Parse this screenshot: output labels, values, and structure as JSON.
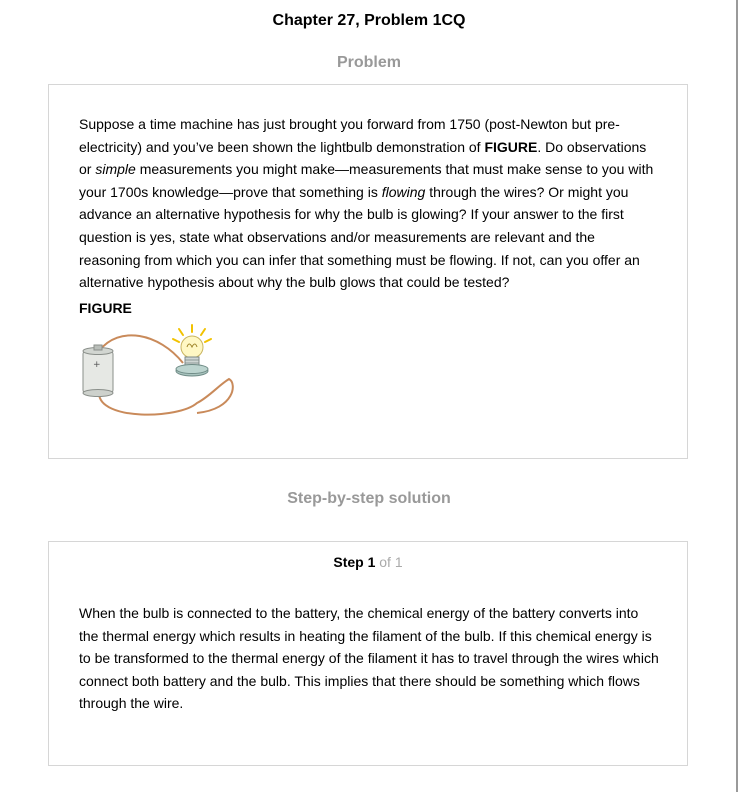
{
  "page_title": "Chapter 27, Problem 1CQ",
  "problem_heading": "Problem",
  "problem": {
    "segments": [
      {
        "text": "Suppose a time machine has just brought you forward from 1750 (post-Newton but pre-electricity) and you’ve been shown the lightbulb demonstration of ",
        "style": "normal"
      },
      {
        "text": "FIGURE",
        "style": "bold"
      },
      {
        "text": ". Do observations or ",
        "style": "normal"
      },
      {
        "text": "simple",
        "style": "italic"
      },
      {
        "text": " measurements you might make—measurements that must make sense to you with your 1700s knowledge—prove that something is ",
        "style": "normal"
      },
      {
        "text": "flowing",
        "style": "italic"
      },
      {
        "text": " through the wires? Or might you advance an alternative hypothesis for why the bulb is glowing? If your answer to the first question is yes, state what observations and/or measurements are relevant and the reasoning from which you can infer that something must be flowing. If not, can you offer an alternative hypothesis about why the bulb glows that could be tested?",
        "style": "normal"
      }
    ],
    "figure_label": "FIGURE",
    "figure_icon": "battery-lightbulb-circuit-illustration",
    "battery_sign": "+"
  },
  "solution_heading": "Step-by-step solution",
  "solution": {
    "step_label": "Step 1",
    "step_of": "of 1",
    "text": "When the bulb is connected to the battery, the chemical energy of the battery converts into the thermal energy which results in heating the filament of the bulb. If this chemical energy is to be transformed to the thermal energy of the filament it has to travel through the wires which connect both battery and the bulb. This implies that there should be something which flows through the wire."
  },
  "colors": {
    "heading_muted": "#999999",
    "card_border": "#d6d6d6",
    "wire": "#c98a5a",
    "glow": "#f2c200"
  }
}
